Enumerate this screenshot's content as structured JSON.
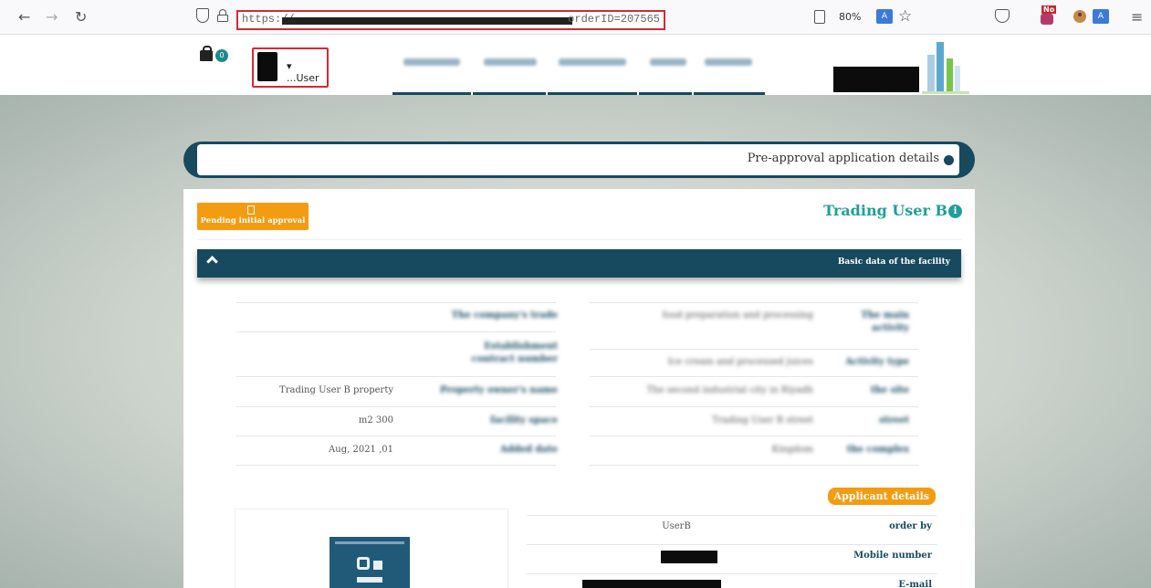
{
  "browser": {
    "url_start": "https://",
    "url_end": "orderID=207565",
    "zoom": "80%",
    "translate_icon_label": "A",
    "ext_badge": "No"
  },
  "header": {
    "cart_count": "0",
    "user_label": "▾ ...User"
  },
  "page": {
    "title": "Pre-approval application details",
    "status_badge": "Pending initial approval",
    "facility_name": "Trading User B",
    "section_title": "Basic data of the facility",
    "facility_values": {
      "property_owner": "Trading User B property",
      "area": "m2 300",
      "date": "Aug, 2021 ,01"
    },
    "applicant": {
      "badge": "Applicant details",
      "rows": [
        {
          "label": "order by",
          "value": "UserB"
        },
        {
          "label": "Mobile number",
          "value": ""
        },
        {
          "label": "E-mail",
          "value": ""
        }
      ]
    }
  },
  "colors": {
    "navy": "#17495f",
    "teal": "#1f9e99",
    "orange": "#f39c12",
    "url_highlight": "#d42a32"
  }
}
